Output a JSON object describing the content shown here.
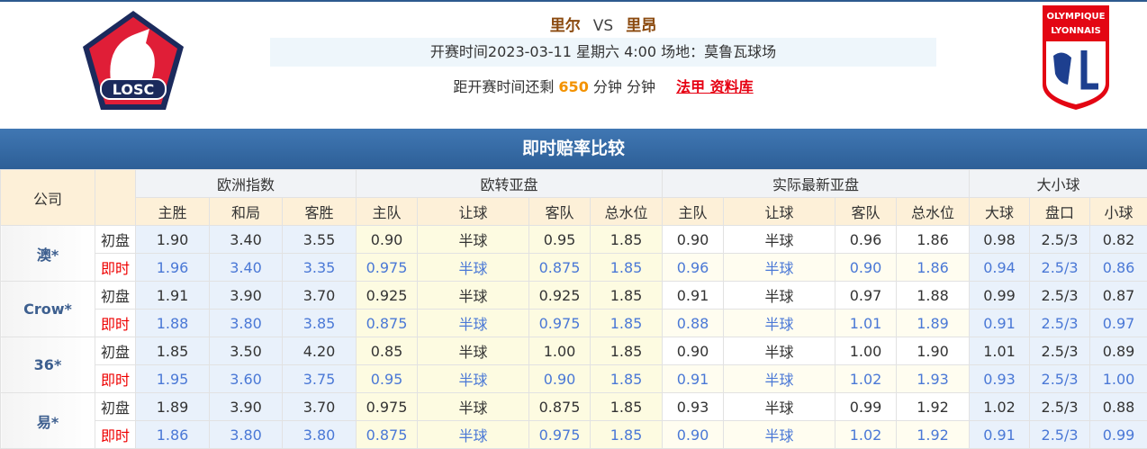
{
  "match": {
    "home": "里尔",
    "vs": "VS",
    "away": "里昂",
    "info": "开赛时间2023-03-11 星期六 4:00  场地：莫鲁瓦球场",
    "countdown_prefix": "距开赛时间还剩",
    "countdown_minutes": "650",
    "countdown_suffix": "分钟 分钟",
    "league_link": "法甲 资料库",
    "home_logo_text": "LOSC",
    "away_logo_text": "OLYMPIQUE LYONNAIS"
  },
  "title": "即时赔率比较",
  "headers": {
    "company": "公司",
    "groups": [
      "欧洲指数",
      "欧转亚盘",
      "实际最新亚盘",
      "大小球"
    ],
    "sub": [
      "主胜",
      "和局",
      "客胜",
      "主队",
      "让球",
      "客队",
      "总水位",
      "主队",
      "让球",
      "客队",
      "总水位",
      "大球",
      "盘口",
      "小球"
    ]
  },
  "labels": {
    "initial": "初盘",
    "live": "即时"
  },
  "rows": [
    {
      "company": "澳*",
      "initial": [
        "1.90",
        "3.40",
        "3.55",
        "0.90",
        "半球",
        "0.95",
        "1.85",
        "0.90",
        "半球",
        "0.96",
        "1.86",
        "0.98",
        "2.5/3",
        "0.82"
      ],
      "live": [
        "1.96",
        "3.40",
        "3.35",
        "0.975",
        "半球",
        "0.875",
        "1.85",
        "0.96",
        "半球",
        "0.90",
        "1.86",
        "0.94",
        "2.5/3",
        "0.86"
      ]
    },
    {
      "company": "Crow*",
      "initial": [
        "1.91",
        "3.90",
        "3.70",
        "0.925",
        "半球",
        "0.925",
        "1.85",
        "0.91",
        "半球",
        "0.97",
        "1.88",
        "0.99",
        "2.5/3",
        "0.87"
      ],
      "live": [
        "1.88",
        "3.80",
        "3.85",
        "0.875",
        "半球",
        "0.975",
        "1.85",
        "0.88",
        "半球",
        "1.01",
        "1.89",
        "0.91",
        "2.5/3",
        "0.97"
      ]
    },
    {
      "company": "36*",
      "initial": [
        "1.85",
        "3.50",
        "4.20",
        "0.85",
        "半球",
        "1.00",
        "1.85",
        "0.90",
        "半球",
        "1.00",
        "1.90",
        "1.01",
        "2.5/3",
        "0.89"
      ],
      "live": [
        "1.95",
        "3.60",
        "3.75",
        "0.95",
        "半球",
        "0.90",
        "1.85",
        "0.91",
        "半球",
        "1.02",
        "1.93",
        "0.93",
        "2.5/3",
        "1.00"
      ]
    },
    {
      "company": "易*",
      "initial": [
        "1.89",
        "3.90",
        "3.70",
        "0.975",
        "半球",
        "0.875",
        "1.85",
        "0.93",
        "半球",
        "0.99",
        "1.92",
        "1.02",
        "2.5/3",
        "0.88"
      ],
      "live": [
        "1.86",
        "3.80",
        "3.80",
        "0.875",
        "半球",
        "0.975",
        "1.85",
        "0.90",
        "半球",
        "1.02",
        "1.92",
        "0.91",
        "2.5/3",
        "0.99"
      ]
    }
  ]
}
